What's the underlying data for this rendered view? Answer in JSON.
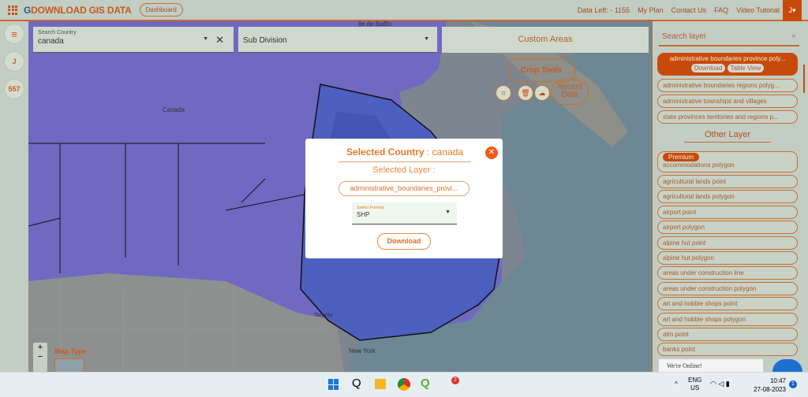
{
  "header": {
    "logo_prefix": "G",
    "logo": "DOWNLOAD GIS DATA",
    "dashboard": "Dashboard",
    "nav": [
      "Data Left: - 1155",
      "My Plan",
      "Contact Us",
      "FAQ",
      "Video Tutorial"
    ],
    "user": "J▾"
  },
  "rail": {
    "menu": "≡",
    "user": "J",
    "count": "557"
  },
  "filters": {
    "country_label": "Search Country",
    "country_value": "canada",
    "subdivision": "Sub Division",
    "custom": "Custom Areas"
  },
  "crop": {
    "title": "Crop Tools",
    "recent": "Recent Data"
  },
  "map": {
    "labels": [
      "Île de Baffin",
      "Canada",
      "Toronto",
      "New York"
    ],
    "map_type": "Map Type",
    "zoom_in": "+",
    "zoom_out": "−"
  },
  "modal": {
    "country_label": "Selected Country",
    "country_value": ": canada",
    "layer_label": "Selected Layer :",
    "layer_value": "administrative_boundaries_provi...",
    "format_label": "Select Format",
    "format_value": "SHP",
    "download": "Download"
  },
  "panel": {
    "search_placeholder": "Search layer",
    "selected": {
      "label": "administrative boundaries province poly...",
      "download": "Download",
      "table": "Table View"
    },
    "country_layers": [
      "administrative boundaries regions polyg...",
      "administrative townships and villages",
      "state provinces territories and regions p..."
    ],
    "other_title": "Other Layer",
    "premium": "Premium",
    "other_layers": [
      "accommodations polygon",
      "agricultural lands point",
      "agricultural lands polygon",
      "airport point",
      "airport polygon",
      "alpine hut point",
      "alpine hut polygon",
      "areas under construction line",
      "areas under construction polygon",
      "art and hobbie shops point",
      "art and hobbie shops polygon",
      "atm point",
      "banks point"
    ],
    "chat": "We're Online!"
  },
  "taskbar": {
    "lang": "ENG",
    "region": "US",
    "time": "10:47",
    "date": "27-08-2023",
    "badge": "2",
    "notif": "1"
  },
  "colors": {
    "accent": "#c84a0a",
    "text_orange": "#e8782a"
  }
}
